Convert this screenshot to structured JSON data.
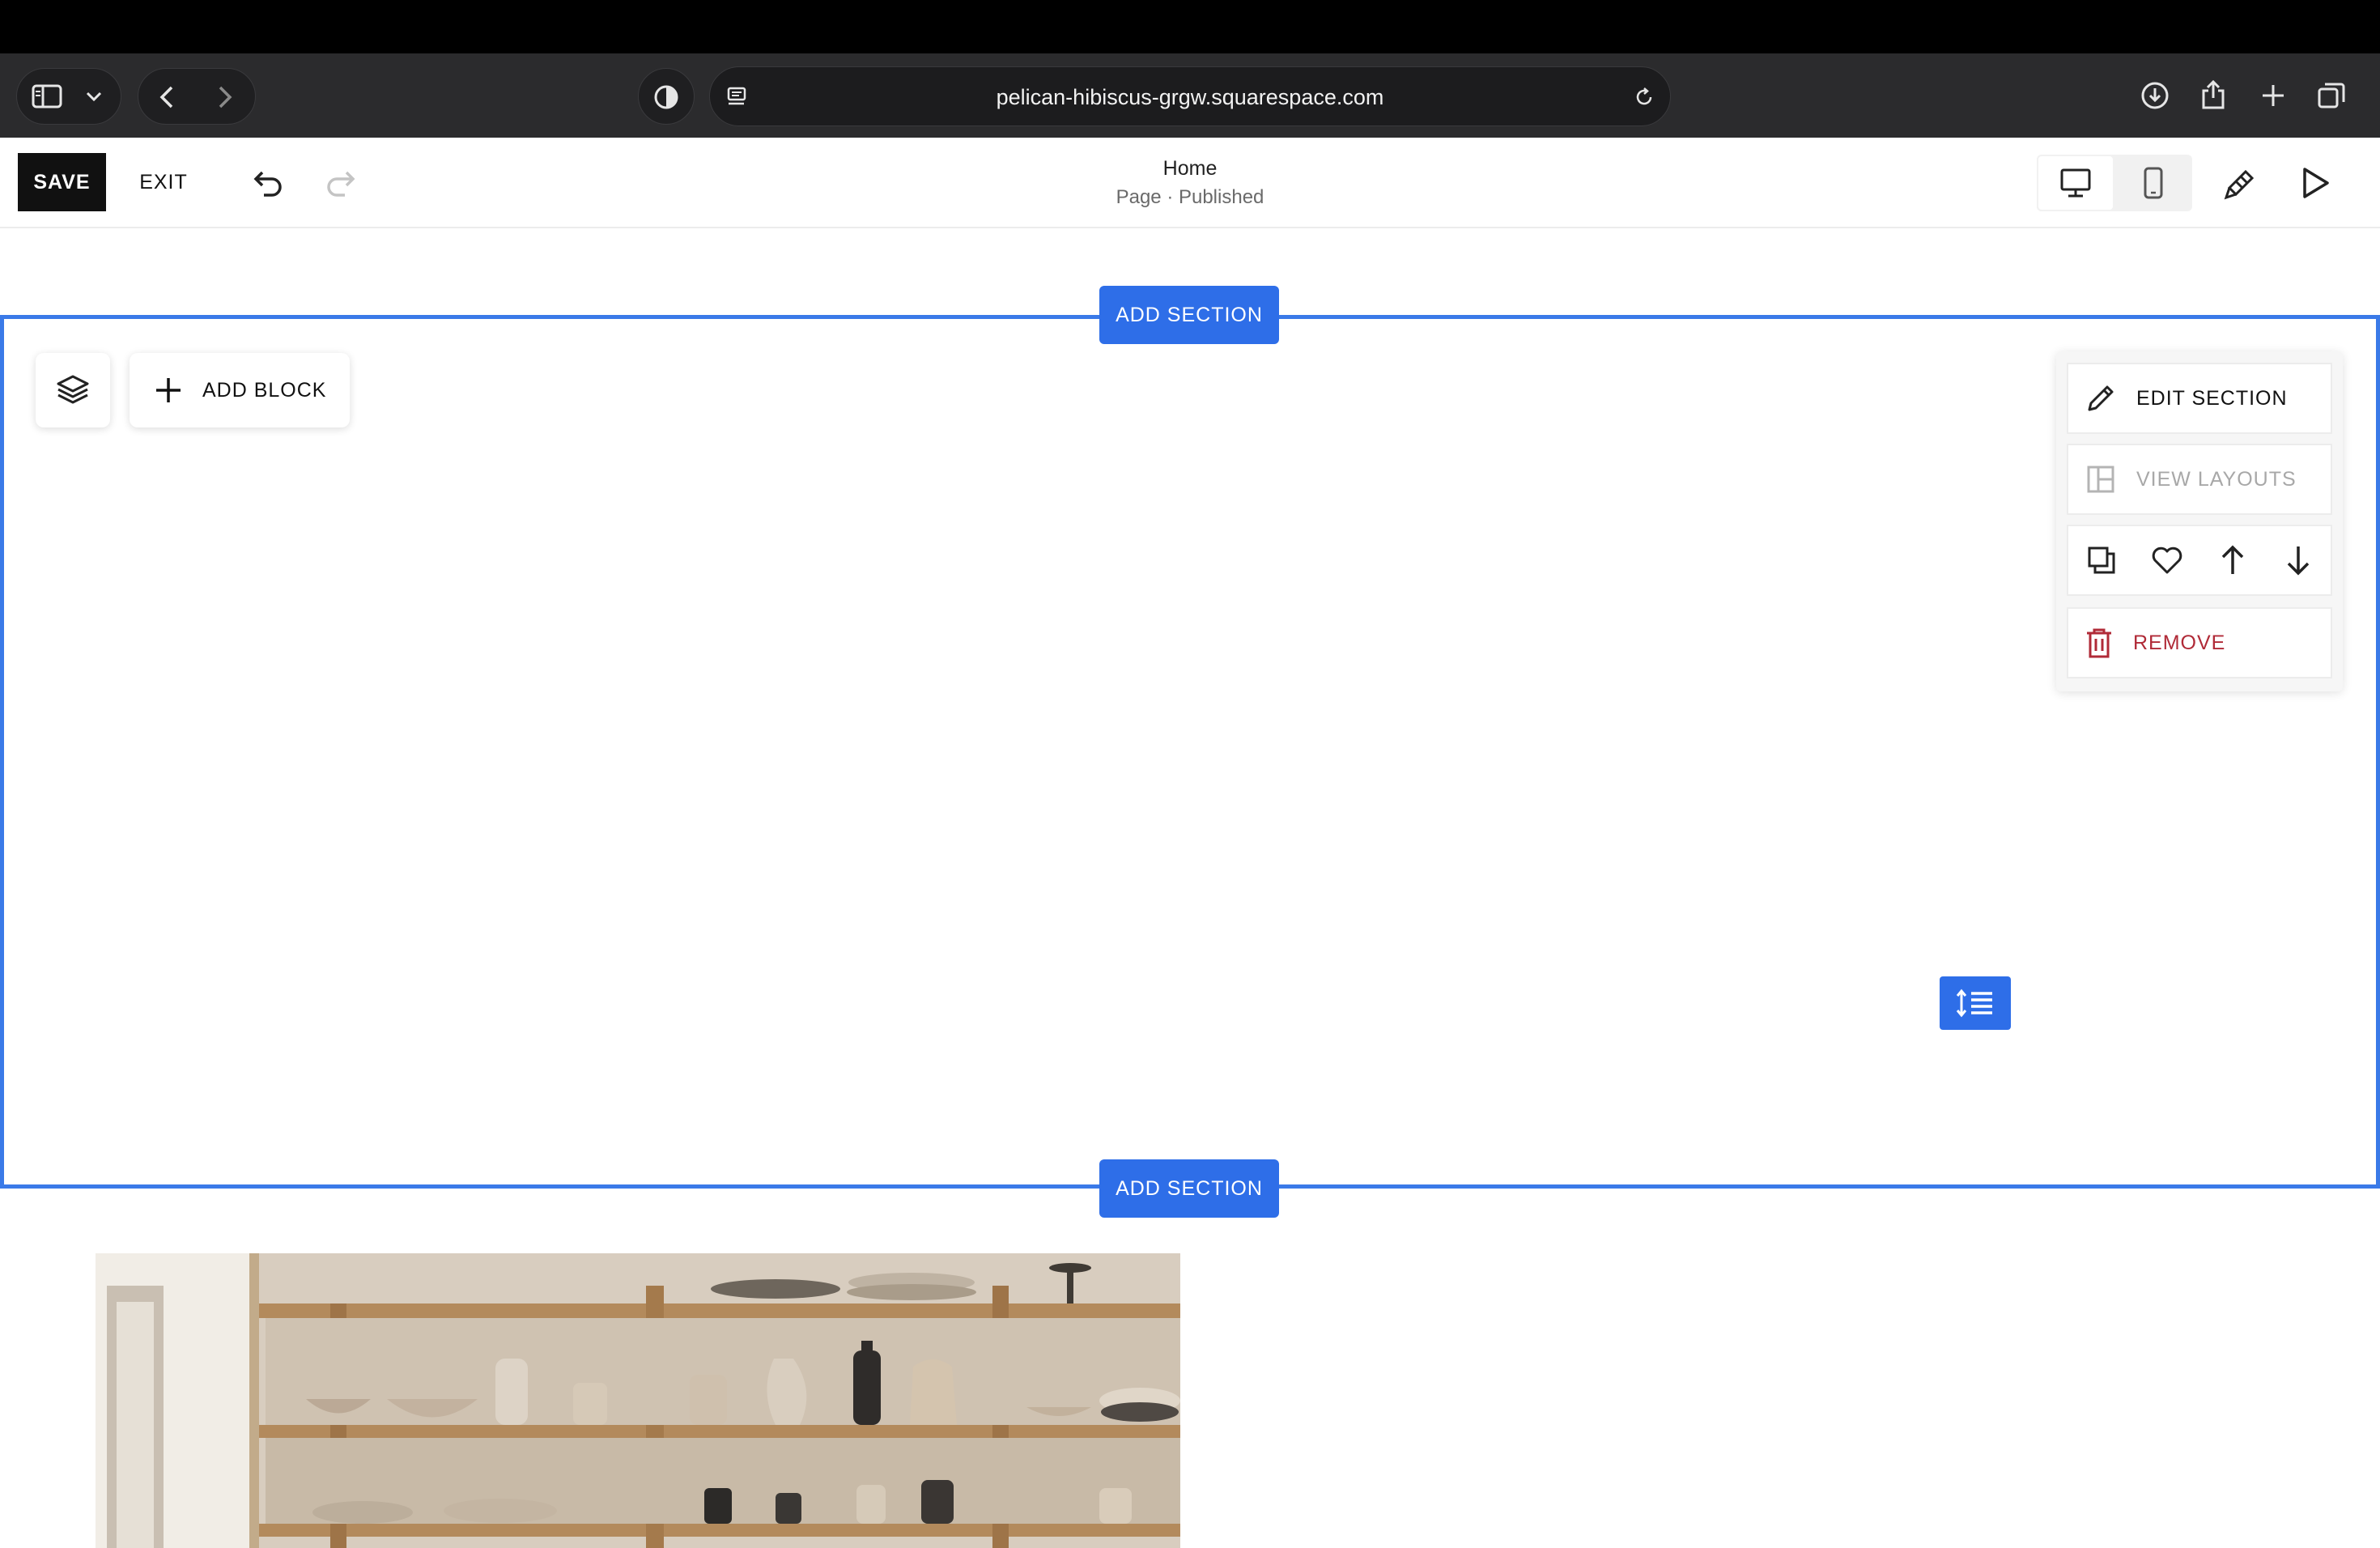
{
  "browser": {
    "url": "pelican-hibiscus-grgw.squarespace.com",
    "icons": [
      "sidebar-icon",
      "chevron-down-icon",
      "back-icon",
      "forward-icon",
      "privacy-shield-icon",
      "reader-icon",
      "reload-icon",
      "download-icon",
      "share-icon",
      "new-tab-icon",
      "tab-overview-icon"
    ]
  },
  "editor": {
    "save_label": "SAVE",
    "exit_label": "EXIT",
    "page_title": "Home",
    "page_status": "Page · Published",
    "icons": [
      "undo-icon",
      "redo-icon",
      "desktop-icon",
      "mobile-icon",
      "site-styles-icon",
      "preview-play-icon"
    ]
  },
  "canvas": {
    "add_section_label": "ADD SECTION",
    "add_block_label": "ADD BLOCK",
    "section_menu": {
      "edit_section": "EDIT SECTION",
      "view_layouts": "VIEW LAYOUTS",
      "remove": "REMOVE",
      "icons": [
        "duplicate-icon",
        "save-to-favorites-icon",
        "move-up-icon",
        "move-down-icon",
        "trash-icon"
      ]
    }
  },
  "colors": {
    "accent_blue": "#2e6ee8",
    "section_outline": "#3a7ae8",
    "danger_red": "#b02a37",
    "browser_chrome": "#2b2b2d"
  }
}
